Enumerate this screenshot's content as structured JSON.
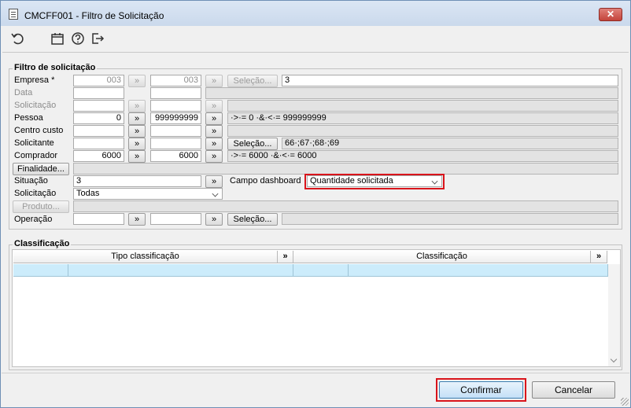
{
  "window": {
    "title": "CMCFF001 - Filtro de Solicitação",
    "close_label": "✕"
  },
  "toolbar": {
    "icons": [
      "refresh-icon",
      "calendar-icon",
      "help-icon",
      "exit-icon"
    ]
  },
  "filtro": {
    "title": "Filtro de solicitação",
    "empresa": {
      "label": "Empresa *",
      "from": "003",
      "to": "003",
      "selecao": "Seleção...",
      "value": "3"
    },
    "data": {
      "label": "Data"
    },
    "solicitacao": {
      "label": "Solicitação"
    },
    "pessoa": {
      "label": "Pessoa",
      "from": "0",
      "to": "999999999",
      "desc": "·>·= 0 ·&·<·= 999999999"
    },
    "centro_custo": {
      "label": "Centro custo"
    },
    "solicitante": {
      "label": "Solicitante",
      "selecao": "Seleção...",
      "value": "66·;67·;68·;69"
    },
    "comprador": {
      "label": "Comprador",
      "from": "6000",
      "to": "6000",
      "desc": "·>·= 6000 ·&·<·= 6000"
    },
    "finalidade": {
      "button": "Finalidade..."
    },
    "situacao": {
      "label": "Situação",
      "value": "3"
    },
    "campo_dashboard": {
      "label": "Campo dashboard",
      "value": "Quantidade solicitada"
    },
    "solicitacao_tipo": {
      "label": "Solicitação",
      "value": "Todas"
    },
    "produto": {
      "button": "Produto..."
    },
    "operacao": {
      "label": "Operação",
      "selecao": "Seleção..."
    },
    "double_arrow": "»",
    "disabled_arrow": "»"
  },
  "classificacao": {
    "title": "Classificação",
    "columns": [
      "Tipo classificação",
      "Classificação"
    ],
    "arrow": "»"
  },
  "footer": {
    "confirm": "Confirmar",
    "cancel": "Cancelar"
  },
  "colors": {
    "accent": "#d9141b",
    "row_selected": "#ccecfb"
  }
}
